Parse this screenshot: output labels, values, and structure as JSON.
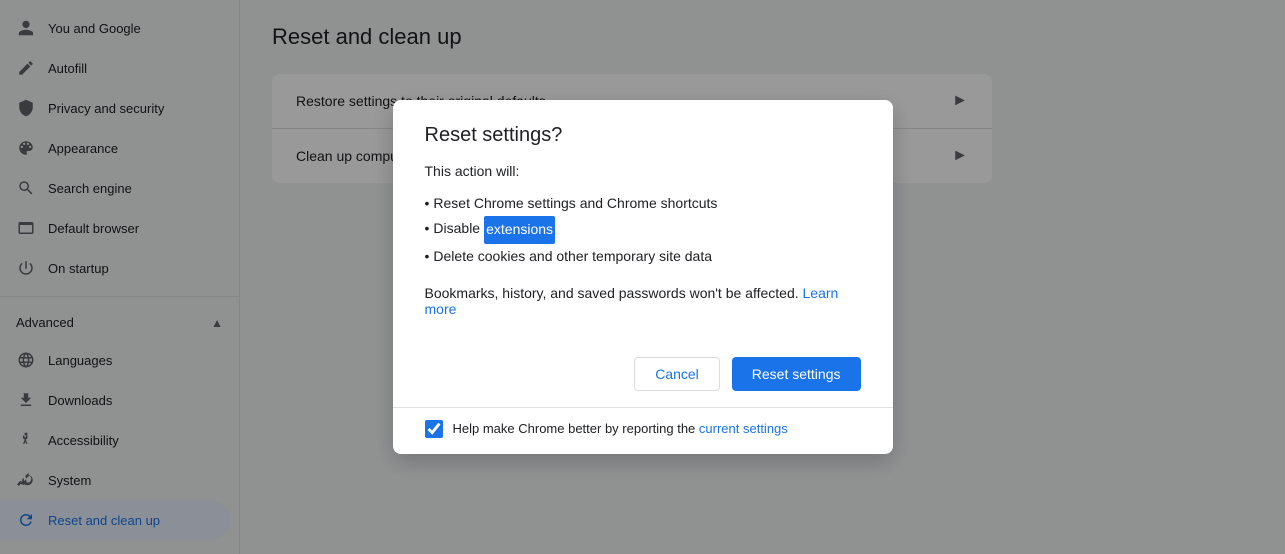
{
  "sidebar": {
    "items": [
      {
        "id": "you-and-google",
        "label": "You and Google",
        "icon": "person",
        "active": false
      },
      {
        "id": "autofill",
        "label": "Autofill",
        "icon": "edit",
        "active": false
      },
      {
        "id": "privacy-and-security",
        "label": "Privacy and security",
        "icon": "shield",
        "active": false
      },
      {
        "id": "appearance",
        "label": "Appearance",
        "icon": "palette",
        "active": false
      },
      {
        "id": "search-engine",
        "label": "Search engine",
        "icon": "search",
        "active": false
      },
      {
        "id": "default-browser",
        "label": "Default browser",
        "icon": "browser",
        "active": false
      },
      {
        "id": "on-startup",
        "label": "On startup",
        "icon": "power",
        "active": false
      }
    ],
    "advanced_section": {
      "label": "Advanced",
      "expanded": true,
      "chevron": "▲"
    },
    "advanced_items": [
      {
        "id": "languages",
        "label": "Languages",
        "icon": "globe",
        "active": false
      },
      {
        "id": "downloads",
        "label": "Downloads",
        "icon": "download",
        "active": false
      },
      {
        "id": "accessibility",
        "label": "Accessibility",
        "icon": "accessibility",
        "active": false
      },
      {
        "id": "system",
        "label": "System",
        "icon": "settings",
        "active": false
      },
      {
        "id": "reset-and-clean-up",
        "label": "Reset and clean up",
        "icon": "reset",
        "active": true
      }
    ]
  },
  "main": {
    "page_title": "Reset and clean up",
    "settings_rows": [
      {
        "id": "restore-defaults",
        "label": "Restore settings to their original defaults"
      },
      {
        "id": "clean-up",
        "label": "Clean up computer..."
      }
    ]
  },
  "dialog": {
    "title": "Reset settings?",
    "subtitle": "This action will:",
    "list_items": [
      {
        "text_before": "",
        "text_highlight": "",
        "text_after": "Reset Chrome settings and Chrome shortcuts"
      },
      {
        "text_before": "Disable ",
        "text_highlight": "extensions",
        "text_after": ""
      },
      {
        "text_before": "",
        "text_highlight": "",
        "text_after": "Delete cookies and other temporary site data"
      }
    ],
    "note_before": "Bookmarks, history, and saved passwords won't be affected. ",
    "note_link": "Learn more",
    "cancel_label": "Cancel",
    "reset_label": "Reset settings",
    "footer_checkbox_checked": true,
    "footer_text_before": "Help make Chrome better by reporting the ",
    "footer_link": "current settings"
  }
}
